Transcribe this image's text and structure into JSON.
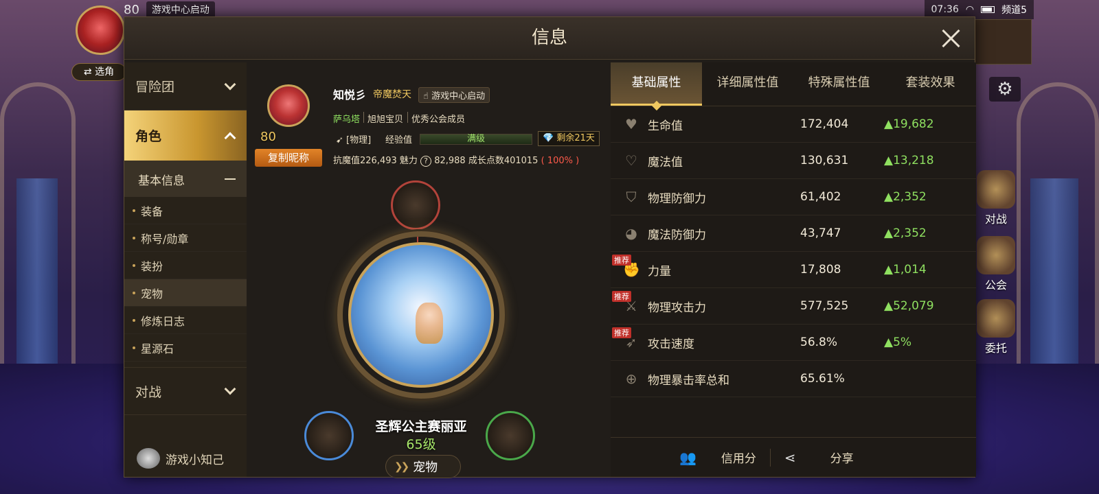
{
  "hud": {
    "level": "80",
    "launch": "游戏中心启动",
    "time": "07:36",
    "channel": "频道5",
    "switch_role": "⇄ 选角"
  },
  "side_menu": [
    {
      "label": "对战",
      "icon": "swords-icon"
    },
    {
      "label": "公会",
      "icon": "guild-icon"
    },
    {
      "label": "委托",
      "icon": "commission-icon"
    }
  ],
  "modal": {
    "title": "信息"
  },
  "nav": {
    "sections": [
      {
        "label": "冒险团"
      },
      {
        "label": "角色"
      },
      {
        "label": "对战"
      }
    ],
    "sub_header": "基本信息",
    "items": [
      "装备",
      "称号/勋章",
      "装扮",
      "宠物",
      "修炼日志",
      "星源石"
    ],
    "tips": "游戏小知己"
  },
  "profile": {
    "name": "知悦彡",
    "class": "帝魔焚天",
    "launch": "游戏中心启动",
    "server": "萨乌塔",
    "guild": "旭旭宝贝",
    "rank": "优秀公会成员",
    "level": "80",
    "copy_button": "复制昵称",
    "tag": "[物理]",
    "exp_label": "经验值",
    "exp_text": "满级",
    "exp_progress": 1.0,
    "remain": "剩余21天",
    "stats_line": "抗魔值226,493 魅力",
    "charm": "82,988",
    "growth": "成长点数401015",
    "growth_pct": "( 100% )"
  },
  "pet": {
    "name": "圣辉公主赛丽亚",
    "level": "65级",
    "button": "宠物"
  },
  "tabs": [
    "基础属性",
    "详细属性值",
    "特殊属性值",
    "套装效果"
  ],
  "stats": [
    {
      "name": "生命值",
      "value": "172,404",
      "inc": "▲19,682",
      "icon": "heart-icon",
      "glyph": "♥",
      "recommend": ""
    },
    {
      "name": "魔法值",
      "value": "130,631",
      "inc": "▲13,218",
      "icon": "heart-outline-icon",
      "glyph": "♡",
      "recommend": ""
    },
    {
      "name": "物理防御力",
      "value": "61,402",
      "inc": "▲2,352",
      "icon": "shield-icon",
      "glyph": "⛉",
      "recommend": ""
    },
    {
      "name": "魔法防御力",
      "value": "43,747",
      "inc": "▲2,352",
      "icon": "orb-icon",
      "glyph": "◕",
      "recommend": ""
    },
    {
      "name": "力量",
      "value": "17,808",
      "inc": "▲1,014",
      "icon": "fist-icon",
      "glyph": "✊",
      "recommend": "推荐"
    },
    {
      "name": "物理攻击力",
      "value": "577,525",
      "inc": "▲52,079",
      "icon": "sword-icon",
      "glyph": "⚔",
      "recommend": "推荐"
    },
    {
      "name": "攻击速度",
      "value": "56.8%",
      "inc": "▲5%",
      "icon": "speed-icon",
      "glyph": "➶",
      "recommend": "推荐"
    },
    {
      "name": "物理暴击率总和",
      "value": "65.61%",
      "inc": "",
      "icon": "crosshair-icon",
      "glyph": "⊕",
      "recommend": ""
    }
  ],
  "bottom": {
    "credit": "信用分",
    "share": "分享"
  }
}
